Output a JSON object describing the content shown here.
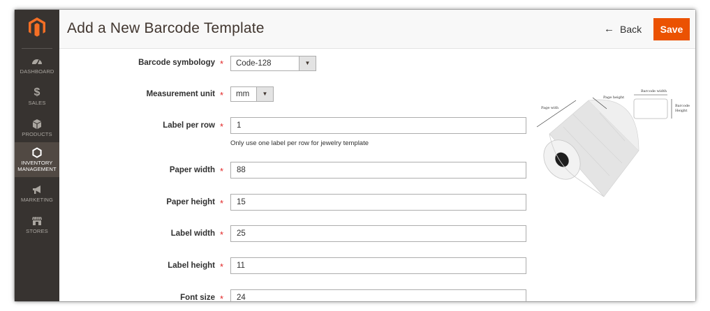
{
  "sidebar": {
    "logo_icon": "magento-logo-icon",
    "items": [
      {
        "label": "DASHBOARD",
        "icon": "dashboard-gauge-icon",
        "active": false
      },
      {
        "label": "SALES",
        "icon": "dollar-icon",
        "active": false
      },
      {
        "label": "PRODUCTS",
        "icon": "cube-icon",
        "active": false
      },
      {
        "label": "INVENTORY MANAGEMENT",
        "line1": "INVENTORY",
        "line2": "MANAGEMENT",
        "icon": "hexagon-icon",
        "active": true
      },
      {
        "label": "MARKETING",
        "icon": "megaphone-icon",
        "active": false
      },
      {
        "label": "STORES",
        "icon": "storefront-icon",
        "active": false
      }
    ]
  },
  "header": {
    "title": "Add a New Barcode Template",
    "back_label": "Back",
    "save_label": "Save"
  },
  "form": {
    "required_mark": "*",
    "barcode_symbology": {
      "label": "Barcode symbology",
      "value": "Code-128"
    },
    "measurement_unit": {
      "label": "Measurement unit",
      "value": "mm"
    },
    "label_per_row": {
      "label": "Label per row",
      "value": "1",
      "note": "Only use one label per row for jewelry template"
    },
    "paper_width": {
      "label": "Paper width",
      "value": "88"
    },
    "paper_height": {
      "label": "Paper height",
      "value": "15"
    },
    "label_width": {
      "label": "Label width",
      "value": "25"
    },
    "label_height": {
      "label": "Label height",
      "value": "11"
    },
    "font_size": {
      "label": "Font size",
      "value": "24"
    }
  },
  "illustration": {
    "page_width": "Page with",
    "page_height": "Page height",
    "barcode_width": "Barcode width",
    "barcode_height_line1": "Barcode",
    "barcode_height_line2": "Height"
  },
  "colors": {
    "sidebar_bg": "#373330",
    "sidebar_active_bg": "#514943",
    "accent": "#eb5202",
    "logo": "#f46f25",
    "required": "#e22626"
  }
}
